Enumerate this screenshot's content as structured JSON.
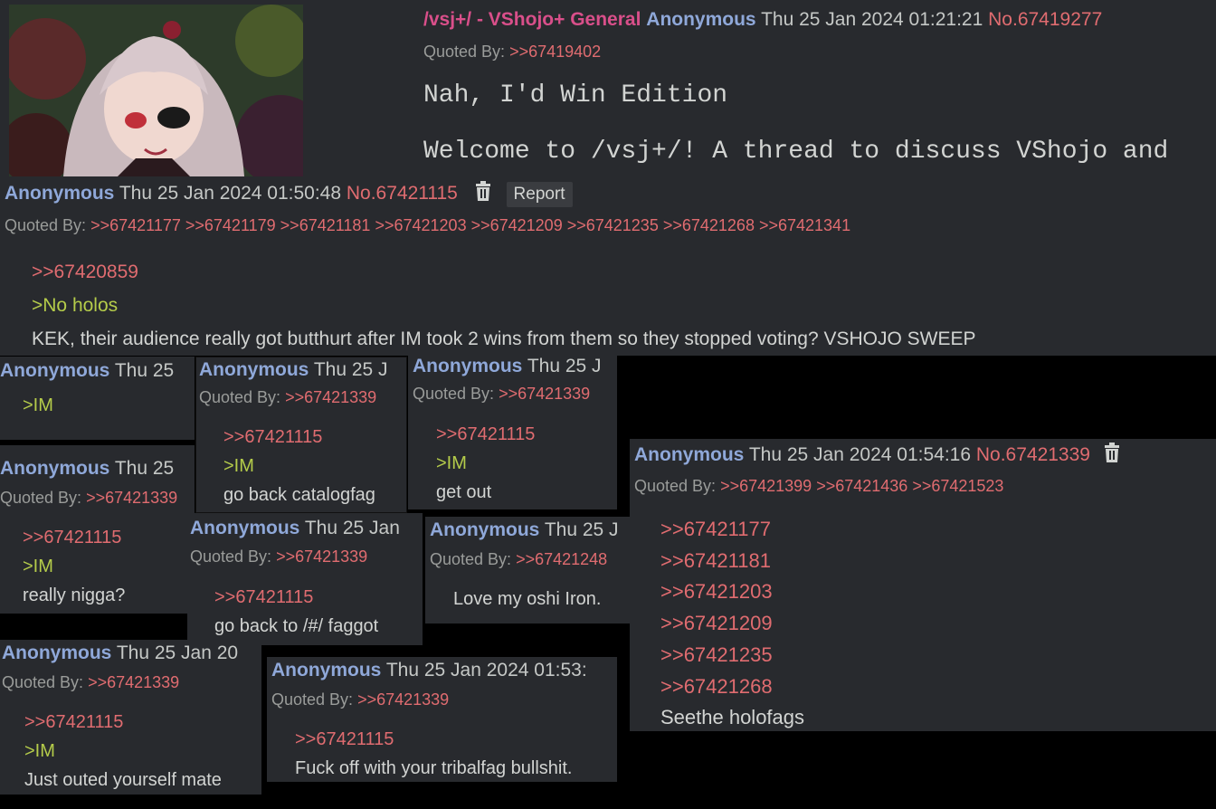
{
  "op": {
    "subject": "/vsj+/ - VShojo+ General",
    "name": "Anonymous",
    "date": "Thu 25 Jan 2024 01:21:21",
    "no": "No.67419277",
    "quoted_by_label": "Quoted By:",
    "quoted_by": [
      ">>67419402"
    ],
    "line1": "Nah, I'd Win Edition",
    "line2": "Welcome to /vsj+/! A thread to discuss VShojo and"
  },
  "main_post": {
    "name": "Anonymous",
    "date": "Thu 25 Jan 2024 01:50:48",
    "no": "No.67421115",
    "report_label": "Report",
    "quoted_by_label": "Quoted By:",
    "quoted_by": [
      ">>67421177",
      ">>67421179",
      ">>67421181",
      ">>67421203",
      ">>67421209",
      ">>67421235",
      ">>67421268",
      ">>67421341"
    ],
    "quote": ">>67420859",
    "greentext": ">No holos",
    "text": "KEK, their audience really got butthurt after IM took 2 wins from them so they stopped voting? VSHOJO SWEEP"
  },
  "popups": {
    "p1": {
      "name": "Anonymous",
      "date": "Thu 25",
      "green": ">IM"
    },
    "p2": {
      "name": "Anonymous",
      "date": "Thu 25 J",
      "quoted_by_label": "Quoted By:",
      "quoted_by": ">>67421339",
      "quote": ">>67421115",
      "green": ">IM",
      "text": "go back catalogfag"
    },
    "p3": {
      "name": "Anonymous",
      "date": "Thu 25 J",
      "quoted_by_label": "Quoted By:",
      "quoted_by": ">>67421339",
      "quote": ">>67421115",
      "green": ">IM",
      "text": "get out"
    },
    "p4": {
      "name": "Anonymous",
      "date": "Thu 25",
      "quoted_by_label": "Quoted By:",
      "quoted_by": ">>67421339",
      "quote": ">>67421115",
      "green": ">IM",
      "text": "really nigga?"
    },
    "p5": {
      "name": "Anonymous",
      "date": "Thu 25 Jan",
      "quoted_by_label": "Quoted By:",
      "quoted_by": ">>67421339",
      "quote": ">>67421115",
      "text": "go back to /#/ faggot"
    },
    "p6": {
      "name": "Anonymous",
      "date": "Thu 25 J",
      "quoted_by_label": "Quoted By:",
      "quoted_by": ">>67421248",
      "text": "Love my oshi Iron."
    },
    "p7": {
      "name": "Anonymous",
      "date": "Thu 25 Jan 2024 01:54:16",
      "no": "No.67421339",
      "quoted_by_label": "Quoted By:",
      "quoted_by": [
        ">>67421399",
        ">>67421436",
        ">>67421523"
      ],
      "quotes": [
        ">>67421177",
        ">>67421181",
        ">>67421203",
        ">>67421209",
        ">>67421235",
        ">>67421268"
      ],
      "text": "Seethe holofags"
    },
    "p8": {
      "name": "Anonymous",
      "date": "Thu 25 Jan 20",
      "quoted_by_label": "Quoted By:",
      "quoted_by": ">>67421339",
      "quote": ">>67421115",
      "green": ">IM",
      "text": "Just outed yourself mate"
    },
    "p9": {
      "name": "Anonymous",
      "date": "Thu 25 Jan 2024 01:53:",
      "quoted_by_label": "Quoted By:",
      "quoted_by": ">>67421339",
      "quote": ">>67421115",
      "text": "Fuck off with your tribalfag bullshit."
    }
  },
  "icons": {
    "trash": "trash-icon"
  },
  "colors": {
    "name": "#8fa8d9",
    "post_no": "#e06c70",
    "greentext": "#b5cc4a",
    "subject": "#d94f8a",
    "panel": "#282a2e"
  }
}
